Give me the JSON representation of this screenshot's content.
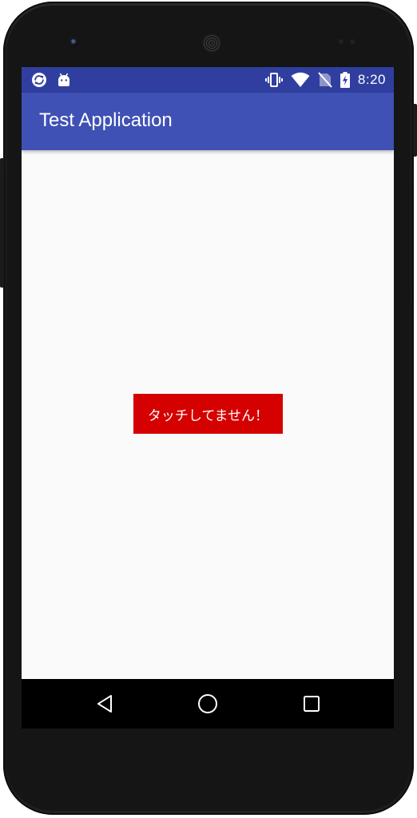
{
  "status_bar": {
    "time": "8:20",
    "left_icons": [
      "sync-icon",
      "android-debug-icon"
    ],
    "right_icons": [
      "vibrate-icon",
      "wifi-icon",
      "no-sim-icon",
      "battery-charging-icon"
    ],
    "background_color": "#303f9f"
  },
  "app_bar": {
    "title": "Test Application",
    "background_color": "#3f51b5"
  },
  "main": {
    "touch_status_text": "タッチしてません！",
    "touch_status_color": "#d50000",
    "background_color": "#fafafa"
  },
  "nav_bar": {
    "buttons": [
      "back-icon",
      "home-icon",
      "recents-icon"
    ]
  }
}
